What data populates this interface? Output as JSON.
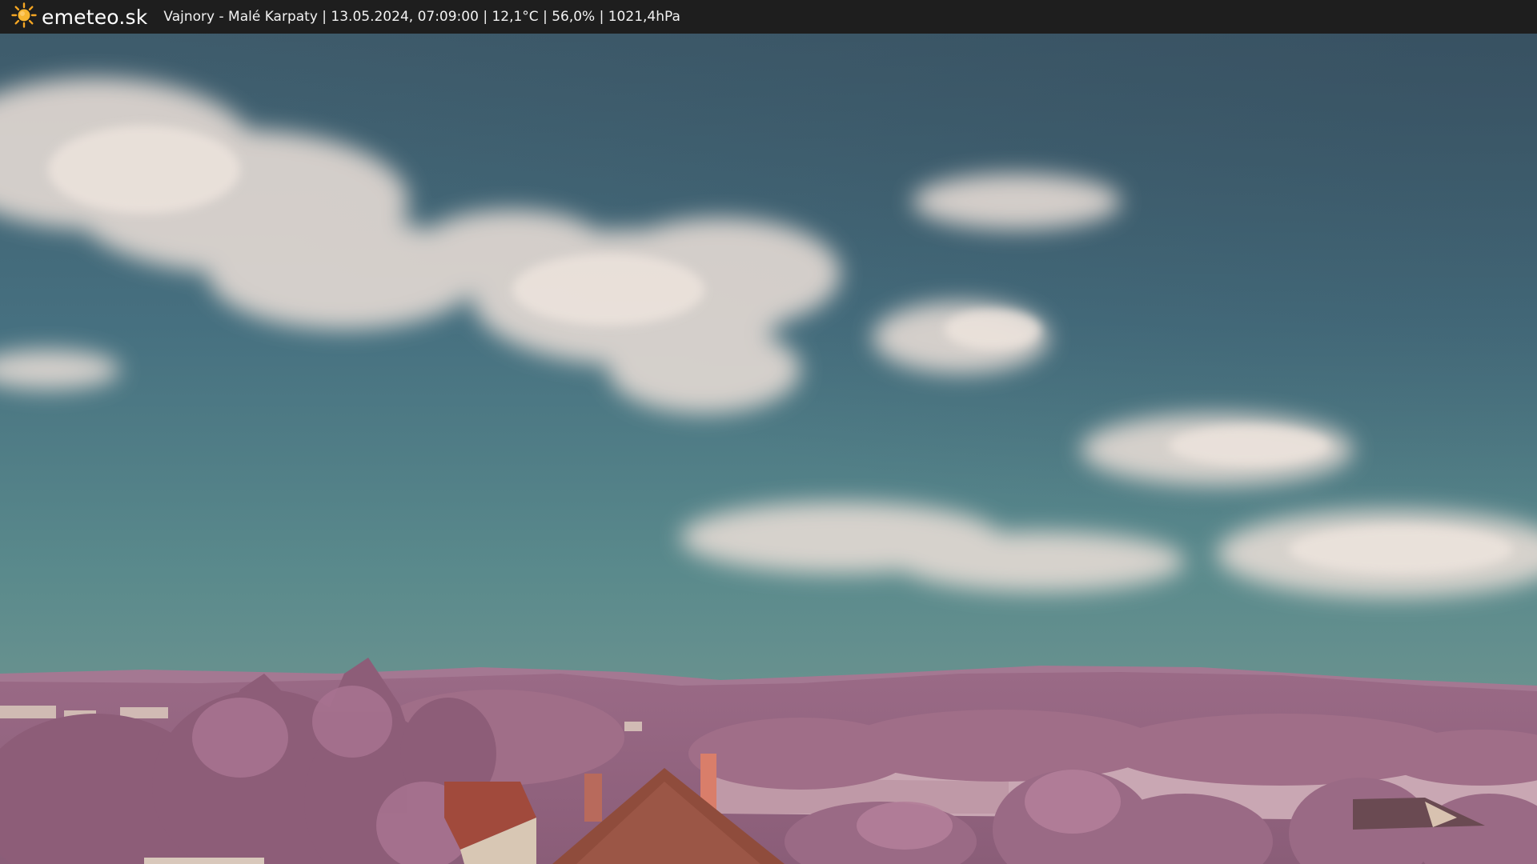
{
  "header": {
    "brand": "emeteo.sk",
    "caption": "Vajnory - Malé Karpaty | 13.05.2024, 07:09:00 | 12,1°C | 56,0% | 1021,4hPa",
    "logo_icon": "sun-icon"
  },
  "colors": {
    "bar": "#1e1e1e",
    "sun": "#f5a623",
    "sky_top": "#3f5e6f",
    "sky_bottom": "#6e9690",
    "clouds": "#e6dcd6",
    "foliage": "#b0788f",
    "roof": "#a54a3c"
  }
}
